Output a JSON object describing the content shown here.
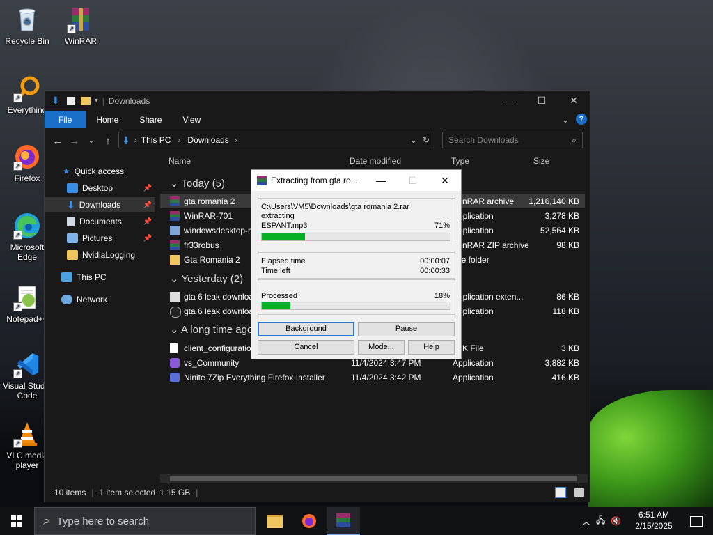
{
  "desktop": {
    "icons": [
      {
        "label": "Recycle Bin",
        "icon": "recycle-bin-icon"
      },
      {
        "label": "WinRAR",
        "icon": "winrar-icon"
      },
      {
        "label": "Everything",
        "icon": "everything-search-icon"
      },
      {
        "label": "Firefox",
        "icon": "firefox-icon"
      },
      {
        "label": "Microsoft Edge",
        "icon": "edge-icon"
      },
      {
        "label": "Notepad++",
        "icon": "notepadpp-icon"
      },
      {
        "label": "Visual Studio Code",
        "icon": "vscode-icon"
      },
      {
        "label": "VLC media player",
        "icon": "vlc-icon"
      }
    ]
  },
  "explorer": {
    "title": "Downloads",
    "ribbon_tabs": [
      "File",
      "Home",
      "Share",
      "View"
    ],
    "breadcrumb": [
      "This PC",
      "Downloads"
    ],
    "search_placeholder": "Search Downloads",
    "nav": [
      {
        "label": "Quick access",
        "icon": "star-icon"
      },
      {
        "label": "Desktop",
        "icon": "desktop-folder-icon",
        "pinned": true
      },
      {
        "label": "Downloads",
        "icon": "downloads-folder-icon",
        "pinned": true
      },
      {
        "label": "Documents",
        "icon": "documents-folder-icon",
        "pinned": true
      },
      {
        "label": "Pictures",
        "icon": "pictures-folder-icon",
        "pinned": true
      },
      {
        "label": "NvidiaLogging",
        "icon": "folder-icon"
      },
      {
        "label": "This PC",
        "icon": "computer-icon"
      },
      {
        "label": "Network",
        "icon": "network-icon"
      }
    ],
    "columns": [
      "Name",
      "Date modified",
      "Type",
      "Size"
    ],
    "groups": [
      {
        "label": "Today (5)",
        "rows": [
          {
            "name": "gta romania 2",
            "date": "",
            "type": "WinRAR archive",
            "size": "1,216,140 KB"
          },
          {
            "name": "WinRAR-701",
            "date": "",
            "type": "Application",
            "size": "3,278 KB"
          },
          {
            "name": "windowsdesktop-r",
            "date": "",
            "type": "Application",
            "size": "52,564 KB"
          },
          {
            "name": "fr33robus",
            "date": "",
            "type": "WinRAR ZIP archive",
            "size": "98 KB"
          },
          {
            "name": "Gta Romania 2",
            "date": "",
            "type": "File folder",
            "size": ""
          }
        ]
      },
      {
        "label": "Yesterday (2)",
        "rows": [
          {
            "name": "gta 6 leak downloa",
            "date": "",
            "type": "Application exten...",
            "size": "86 KB"
          },
          {
            "name": "gta 6 leak downloa",
            "date": "",
            "type": "Application",
            "size": "118 KB"
          }
        ]
      },
      {
        "label": "A long time ago",
        "rows": [
          {
            "name": "client_configuratio",
            "date": "",
            "type": "JSK File",
            "size": "3 KB"
          },
          {
            "name": "vs_Community",
            "date": "11/4/2024 3:47 PM",
            "type": "Application",
            "size": "3,882 KB"
          },
          {
            "name": "Ninite 7Zip Everything Firefox Installer",
            "date": "11/4/2024 3:42 PM",
            "type": "Application",
            "size": "416 KB"
          }
        ]
      }
    ],
    "status": {
      "items": "10 items",
      "selected": "1 item selected",
      "size": "1.15 GB"
    }
  },
  "dialog": {
    "title": "Extracting from gta ro...",
    "archive_path": "C:\\Users\\VM5\\Downloads\\gta romania 2.rar",
    "action": "extracting",
    "file": "ESPANT.mp3",
    "file_percent_label": "71%",
    "file_progress": 0.23,
    "elapsed_label": "Elapsed time",
    "elapsed": "00:00:07",
    "left_label": "Time left",
    "left": "00:00:33",
    "processed_label": "Processed",
    "processed_percent_label": "18%",
    "processed_progress": 0.15,
    "buttons": {
      "background": "Background",
      "pause": "Pause",
      "cancel": "Cancel",
      "mode": "Mode...",
      "help": "Help"
    }
  },
  "taskbar": {
    "search_placeholder": "Type here to search",
    "time": "6:51 AM",
    "date": "2/15/2025"
  },
  "colors": {
    "accent": "#1a6fc9",
    "progress": "#06b025",
    "tent": "#5cc02a"
  }
}
